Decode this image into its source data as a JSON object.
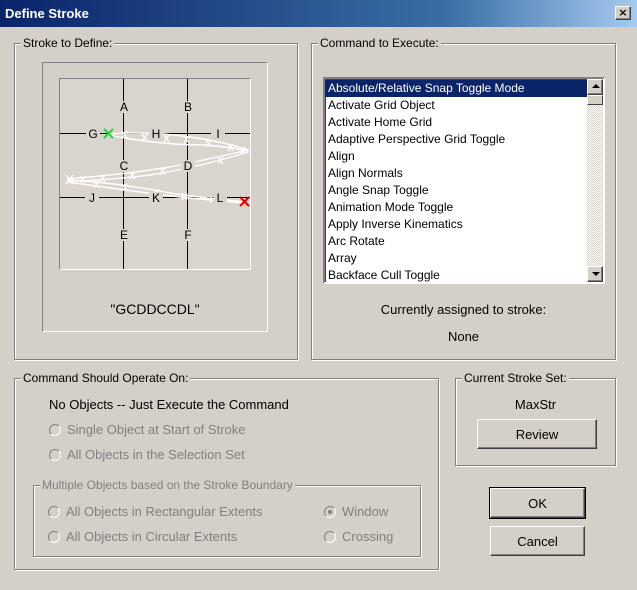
{
  "window": {
    "title": "Define Stroke",
    "close_label": "×"
  },
  "stroke_group": {
    "legend": "Stroke to Define:",
    "cell_labels": [
      "A",
      "B",
      "G",
      "H",
      "I",
      "C",
      "D",
      "J",
      "K",
      "L",
      "E",
      "F"
    ],
    "stroke_code": "\"GCDDCCDL\""
  },
  "command_group": {
    "legend": "Command to Execute:",
    "items": [
      "Absolute/Relative Snap Toggle Mode",
      "Activate Grid Object",
      "Activate Home Grid",
      "Adaptive Perspective Grid Toggle",
      "Align",
      "Align Normals",
      "Angle Snap Toggle",
      "Animation Mode Toggle",
      "Apply Inverse Kinematics",
      "Arc Rotate",
      "Array",
      "Backface Cull Toggle"
    ],
    "selected_index": 0,
    "assigned_label": "Currently assigned to stroke:",
    "assigned_value": "None"
  },
  "operate_group": {
    "legend": "Command Should Operate On:",
    "no_objects_label": "No Objects -- Just Execute the Command",
    "single_object_label": "Single Object at Start of Stroke",
    "all_selection_label": "All Objects in the Selection Set",
    "multiple_legend": "Multiple Objects based on the Stroke Boundary",
    "rect_extents_label": "All Objects in Rectangular Extents",
    "circ_extents_label": "All Objects in Circular Extents",
    "window_label": "Window",
    "crossing_label": "Crossing"
  },
  "stroke_set_group": {
    "legend": "Current Stroke Set:",
    "set_name": "MaxStr",
    "review_label": "Review"
  },
  "ok_label": "OK",
  "cancel_label": "Cancel"
}
